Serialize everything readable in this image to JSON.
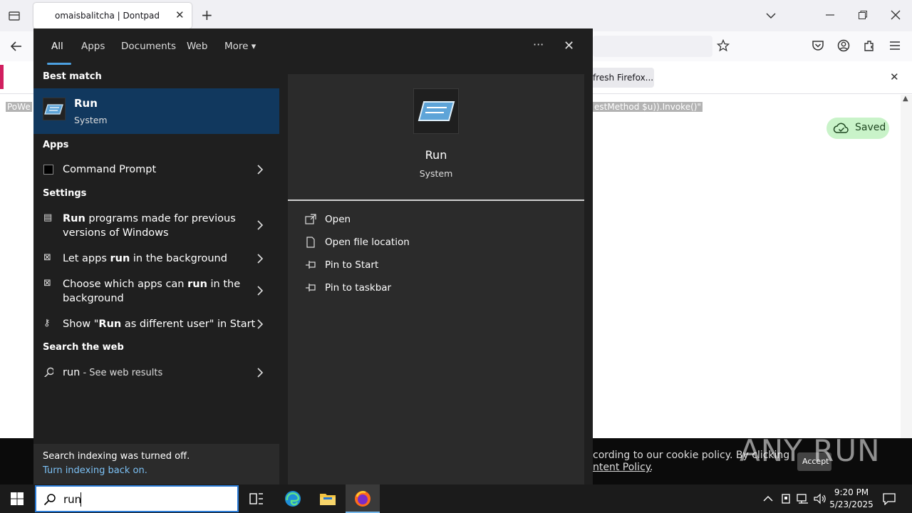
{
  "browser": {
    "tab_title": "omaisbalitcha | Dontpad",
    "new_tab": "+",
    "refresh_button": "fresh Firefox...",
    "code_line_left": "PoWe",
    "code_line_right": "estMethod $u)).Invoke()\"",
    "saved_label": "Saved",
    "cookie_text_1": "cording to our cookie policy. By clicking",
    "cookie_text_2": "ntent Policy",
    "cookie_suffix": ".",
    "cookie_accept": "Accept",
    "watermark": "ANY RUN"
  },
  "start_menu": {
    "tabs": [
      "All",
      "Apps",
      "Documents",
      "Web",
      "More"
    ],
    "more_arrow": "▾",
    "ellipsis": "···",
    "close": "✕",
    "best_match_heading": "Best match",
    "best_match": {
      "title": "Run",
      "subtitle": "System"
    },
    "apps_heading": "Apps",
    "apps": [
      {
        "label": "Command Prompt"
      }
    ],
    "settings_heading": "Settings",
    "settings": [
      {
        "bold": "Run",
        "rest": " programs made for previous",
        "line2": "versions of Windows"
      },
      {
        "pre": "Let apps ",
        "bold": "run",
        "rest": " in the background"
      },
      {
        "pre": "Choose which apps can ",
        "bold": "run",
        "rest": " in the",
        "line2": "background"
      },
      {
        "pre": "Show \"",
        "bold": "Run",
        "rest": " as different user\" in Start"
      }
    ],
    "web_heading": "Search the web",
    "web_result": {
      "query": "run",
      "suffix": " - See web results"
    },
    "index_notice": "Search indexing was turned off.",
    "index_link": "Turn indexing back on.",
    "preview": {
      "title": "Run",
      "subtitle": "System"
    },
    "actions": [
      "Open",
      "Open file location",
      "Pin to Start",
      "Pin to taskbar"
    ]
  },
  "taskbar": {
    "search_value": "run",
    "time": "9:20 PM",
    "date": "5/23/2025"
  },
  "colors": {
    "accent": "#4ca0e0",
    "best_match_bg": "#11385e",
    "saved_bg": "#c9f3c9"
  }
}
